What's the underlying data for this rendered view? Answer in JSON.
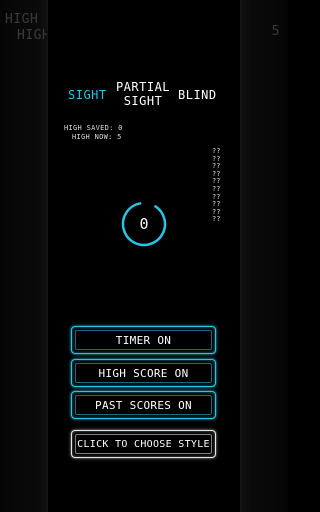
{
  "background": {
    "ghost_lines": [
      "HIGH S",
      "HIGH"
    ],
    "ghost_number": "5"
  },
  "modes": {
    "sight": "SIGHT",
    "partial_line1": "PARTIAL",
    "partial_line2": "SIGHT",
    "blind": "BLIND",
    "selected": "sight"
  },
  "stats": {
    "high_saved": "HIGH SAVED: 0",
    "high_now": "HIGH NOW: 5"
  },
  "past_scores": [
    "??",
    "??",
    "??",
    "??",
    "??",
    "??",
    "??",
    "??",
    "??",
    "??"
  ],
  "counter": {
    "value": "0"
  },
  "buttons": {
    "timer": "TIMER ON",
    "high_score": "HIGH SCORE ON",
    "past_scores": "PAST SCORES ON",
    "choose_style": "CLICK TO CHOOSE STYLE"
  },
  "colors": {
    "accent": "#29c4e6",
    "background": "#000000",
    "text": "#ffffff"
  }
}
